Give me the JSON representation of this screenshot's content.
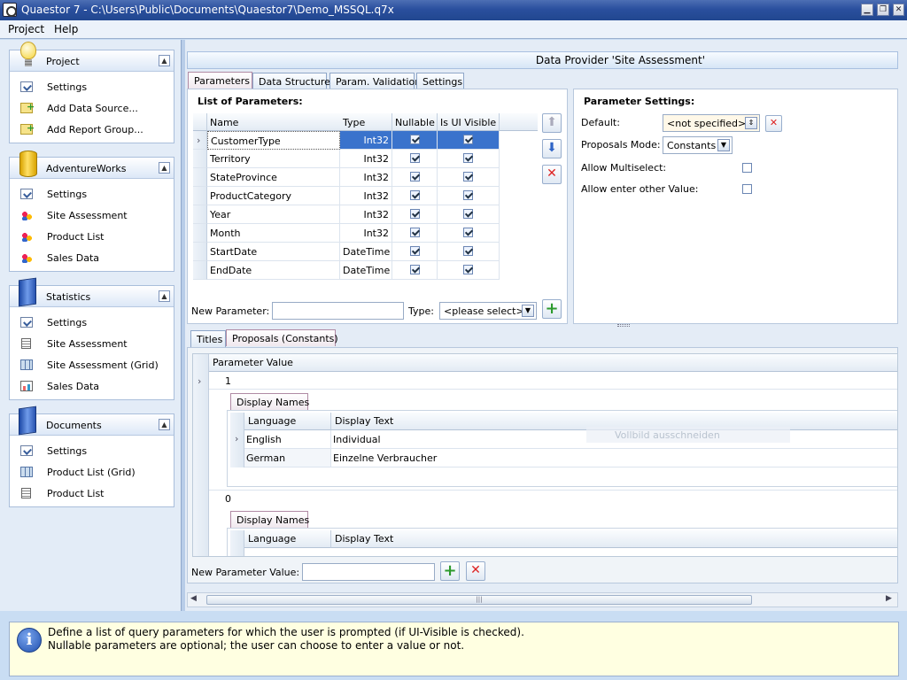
{
  "window": {
    "title": "Quaestor 7 - C:\\Users\\Public\\Documents\\Quaestor7\\Demo_MSSQL.q7x"
  },
  "menu": {
    "project": "Project",
    "help": "Help"
  },
  "sidebar": {
    "groups": [
      {
        "title": "Project",
        "items": [
          {
            "label": "Settings",
            "icon": "settings-check-icon"
          },
          {
            "label": "Add Data Source...",
            "icon": "add-datasource-icon"
          },
          {
            "label": "Add Report Group...",
            "icon": "add-report-group-icon"
          }
        ]
      },
      {
        "title": "AdventureWorks",
        "items": [
          {
            "label": "Settings",
            "icon": "settings-check-icon"
          },
          {
            "label": "Site Assessment",
            "icon": "report-icon"
          },
          {
            "label": "Product List",
            "icon": "report-icon"
          },
          {
            "label": "Sales Data",
            "icon": "report-icon"
          }
        ]
      },
      {
        "title": "Statistics",
        "items": [
          {
            "label": "Settings",
            "icon": "settings-check-icon"
          },
          {
            "label": "Site Assessment",
            "icon": "document-icon"
          },
          {
            "label": "Site Assessment (Grid)",
            "icon": "grid-icon"
          },
          {
            "label": "Sales Data",
            "icon": "chart-icon"
          }
        ]
      },
      {
        "title": "Documents",
        "items": [
          {
            "label": "Settings",
            "icon": "settings-check-icon"
          },
          {
            "label": "Product List (Grid)",
            "icon": "grid-icon"
          },
          {
            "label": "Product List",
            "icon": "document-icon"
          }
        ]
      }
    ]
  },
  "main": {
    "header": "Data Provider 'Site Assessment'",
    "tabs": [
      "Parameters",
      "Data Structure",
      "Param. Validation",
      "Settings"
    ],
    "list_title": "List of Parameters:",
    "grid": {
      "columns": [
        "Name",
        "Type",
        "Nullable",
        "Is UI Visible"
      ],
      "rows": [
        {
          "name": "CustomerType",
          "type": "Int32",
          "nullable": true,
          "visible": true
        },
        {
          "name": "Territory",
          "type": "Int32",
          "nullable": true,
          "visible": true
        },
        {
          "name": "StateProvince",
          "type": "Int32",
          "nullable": true,
          "visible": true
        },
        {
          "name": "ProductCategory",
          "type": "Int32",
          "nullable": true,
          "visible": true
        },
        {
          "name": "Year",
          "type": "Int32",
          "nullable": true,
          "visible": true
        },
        {
          "name": "Month",
          "type": "Int32",
          "nullable": true,
          "visible": true
        },
        {
          "name": "StartDate",
          "type": "DateTime",
          "nullable": true,
          "visible": true
        },
        {
          "name": "EndDate",
          "type": "DateTime",
          "nullable": true,
          "visible": true
        }
      ]
    },
    "new_param_label": "New Parameter:",
    "type_label": "Type:",
    "type_select": "<please select>",
    "settings": {
      "title": "Parameter Settings:",
      "default_label": "Default:",
      "default_value": "<not specified>",
      "proposals_label": "Proposals Mode:",
      "proposals_value": "Constants",
      "multiselect_label": "Allow Multiselect:",
      "enter_other_label": "Allow enter other Value:"
    },
    "lower_tabs": [
      "Titles",
      "Proposals (Constants)"
    ],
    "proposals": {
      "col": "Parameter Value",
      "values": [
        "1",
        "0"
      ],
      "display_names_tab": "Display Names",
      "dn_columns": [
        "Language",
        "Display Text"
      ],
      "dn_rows": [
        {
          "language": "English",
          "text": "Individual"
        },
        {
          "language": "German",
          "text": "Einzelne Verbraucher"
        }
      ],
      "ghost_text": "Vollbild ausschneiden",
      "new_value_label": "New Parameter Value:"
    }
  },
  "info": {
    "line1": "Define a list of query parameters for which the user is prompted (if UI-Visible is checked).",
    "line2": "Nullable parameters are optional; the user can choose to enter a value or not."
  },
  "colors": {
    "accent": "#3a73cc",
    "selected_tab": "#b08aa4",
    "info_bg": "#ffffe1"
  }
}
